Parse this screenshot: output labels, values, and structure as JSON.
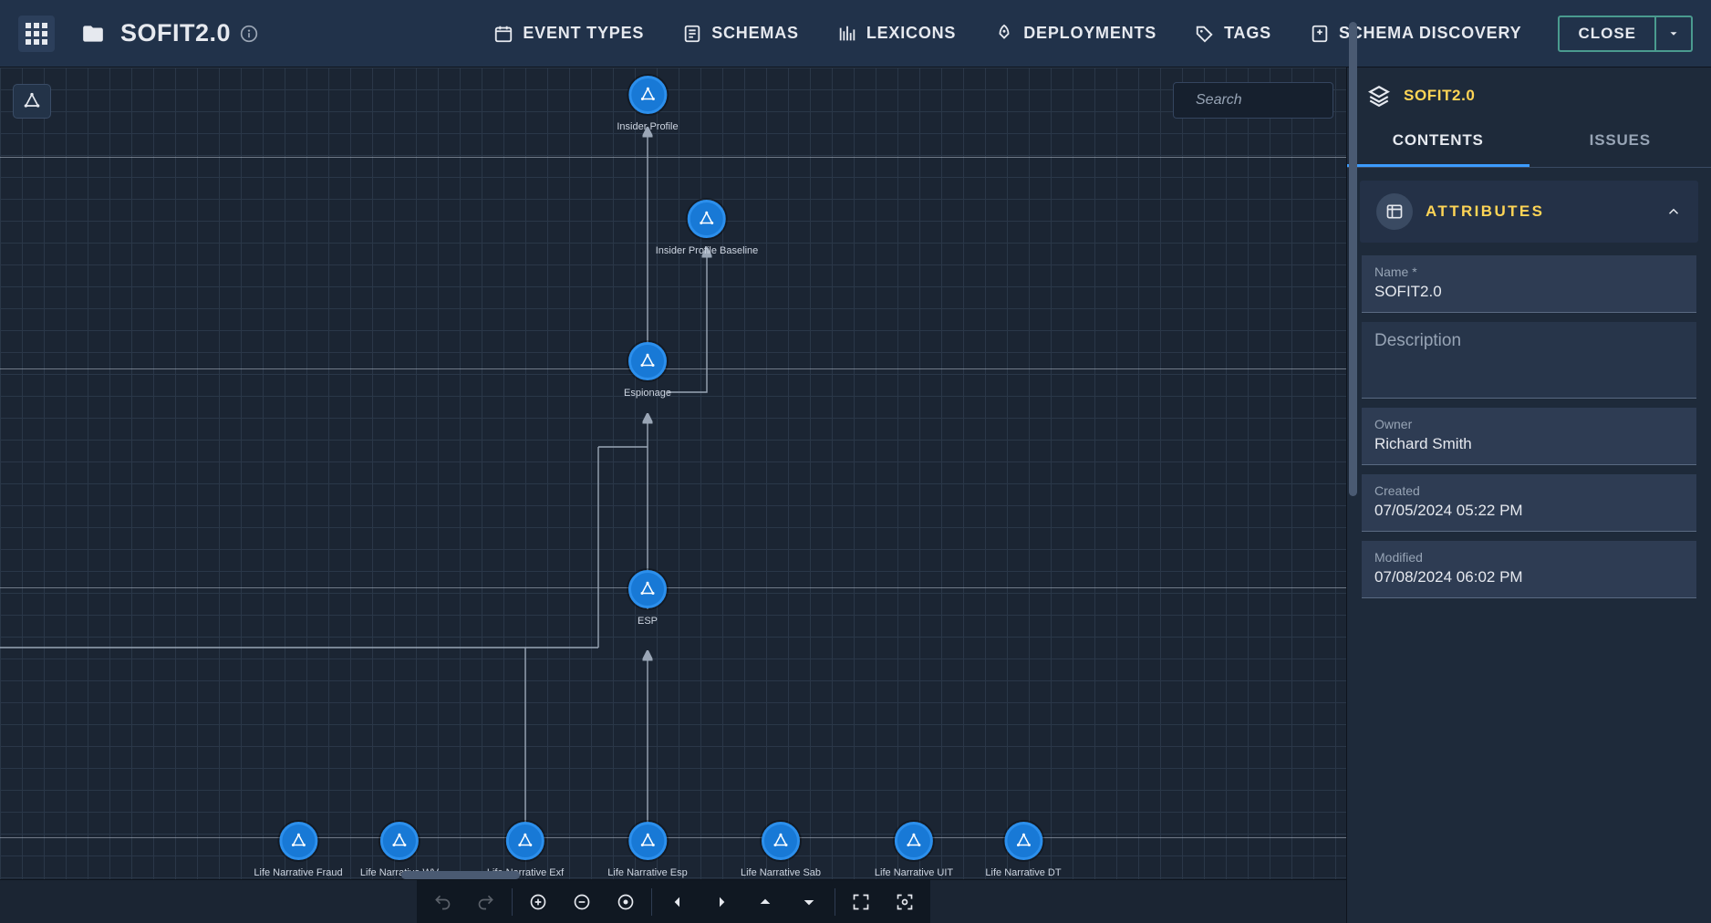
{
  "header": {
    "app_title": "SOFIT2.0",
    "nav": {
      "event_types": "EVENT TYPES",
      "schemas": "SCHEMAS",
      "lexicons": "LEXICONS",
      "deployments": "DEPLOYMENTS",
      "tags": "TAGS",
      "schema_discovery": "SCHEMA DISCOVERY"
    },
    "close_label": "CLOSE"
  },
  "search": {
    "placeholder": "Search"
  },
  "side": {
    "title": "SOFIT2.0",
    "tabs": {
      "contents": "CONTENTS",
      "issues": "ISSUES"
    },
    "section": {
      "attributes": "ATTRIBUTES"
    },
    "fields": {
      "name_label": "Name *",
      "name_value": "SOFIT2.0",
      "description_placeholder": "Description",
      "owner_label": "Owner",
      "owner_value": "Richard Smith",
      "created_label": "Created",
      "created_value": "07/05/2024 05:22 PM",
      "modified_label": "Modified",
      "modified_value": "07/08/2024 06:02 PM"
    }
  },
  "nodes": {
    "insider_profile": "Insider Profile",
    "insider_profile_baseline": "Insider Profile Baseline",
    "espionage": "Espionage",
    "esp": "ESP",
    "ln_fraud": "Life Narrative Fraud",
    "ln_wv": "Life Narrative WV",
    "ln_exf": "Life Narrative Exf",
    "ln_esp": "Life Narrative Esp",
    "ln_sab": "Life Narrative Sab",
    "ln_uit": "Life Narrative UIT",
    "ln_dt": "Life Narrative  DT"
  }
}
